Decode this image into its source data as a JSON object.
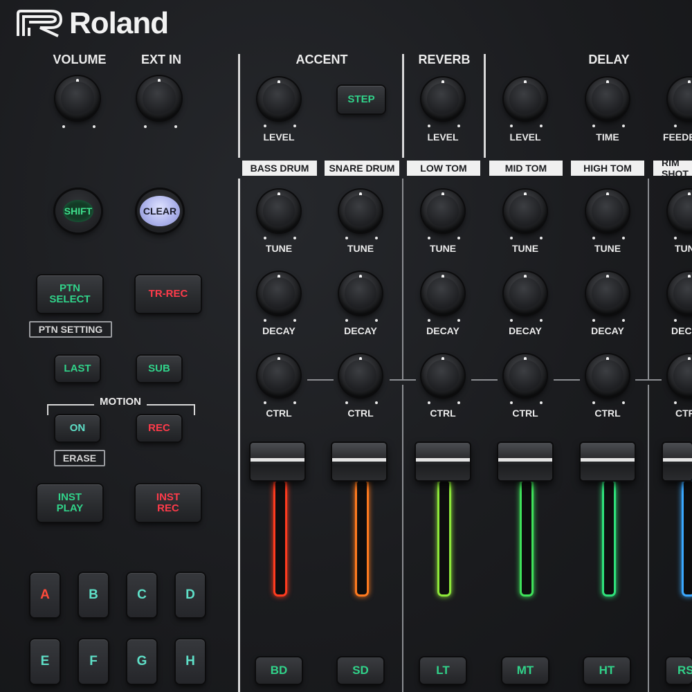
{
  "brand": {
    "name": "Roland"
  },
  "top_left": {
    "volume": "VOLUME",
    "ext_in": "EXT IN"
  },
  "sections": {
    "accent": "ACCENT",
    "reverb": "REVERB",
    "delay": "DELAY"
  },
  "knob_labels": {
    "level": "LEVEL",
    "time": "TIME",
    "feedback": "FEEDBACK",
    "tune": "TUNE",
    "decay": "DECAY",
    "ctrl": "CTRL"
  },
  "buttons": {
    "step": "STEP",
    "shift": "SHIFT",
    "clear": "CLEAR",
    "ptn_select": "PTN SELECT",
    "tr_rec": "TR-REC",
    "ptn_setting": "PTN SETTING",
    "last": "LAST",
    "sub": "SUB",
    "motion": "MOTION",
    "on": "ON",
    "rec": "REC",
    "erase": "ERASE",
    "inst_play": "INST PLAY",
    "inst_rec": "INST REC"
  },
  "pads": [
    "A",
    "B",
    "C",
    "D",
    "E",
    "F",
    "G",
    "H"
  ],
  "instruments": [
    {
      "name": "BASS DRUM",
      "short": "BD",
      "color": "#ff3b1f"
    },
    {
      "name": "SNARE DRUM",
      "short": "SD",
      "color": "#ff7a1f"
    },
    {
      "name": "LOW TOM",
      "short": "LT",
      "color": "#8ee83a"
    },
    {
      "name": "MID TOM",
      "short": "MT",
      "color": "#3fe05a"
    },
    {
      "name": "HIGH TOM",
      "short": "HT",
      "color": "#2fe07a"
    },
    {
      "name": "RIM SHOT",
      "short": "RS",
      "color": "#3aa8ff"
    }
  ],
  "colors": {
    "accent_green": "#31d38a",
    "accent_red": "#ff3b4a",
    "panel": "#1b1c1f"
  }
}
